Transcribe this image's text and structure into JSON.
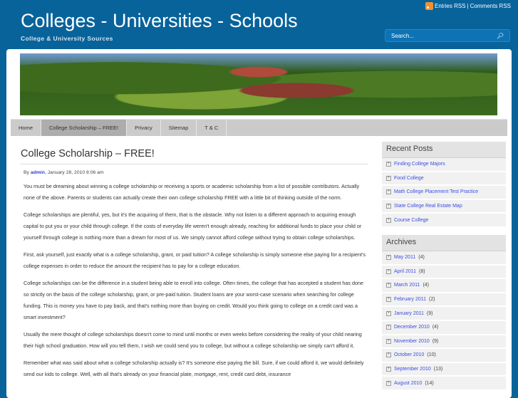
{
  "header": {
    "title": "Colleges - Universities - Schools",
    "tagline": "College & University Sources",
    "rss_entries": "Entries RSS",
    "rss_sep": "|",
    "rss_comments": "Comments RSS",
    "search_placeholder": "Search..."
  },
  "nav": [
    "Home",
    "College Scholarship – FREE!",
    "Privacy",
    "Sitemap",
    "T & C"
  ],
  "post": {
    "title": "College Scholarship – FREE!",
    "by": "By",
    "author": "admin",
    "date": ", January 28, 2010 8:06 am",
    "paragraphs": [
      "You must be dreaming about winning a college scholarship or receiving a sports or academic scholarship from a list of possible contributors. Actually none of the above. Parents or students can actually create their own college scholarship FREE with a little bit of thinking outside of the norm.",
      "College scholarships are plentiful, yes, but it's the acquiring of them, that is the obstacle. Why not listen to a different approach to acquiring enough capital to put you or your child through college. If the costs of everyday life weren't enough already, reaching for additional funds to place your child or yourself through college is nothing more than a dream for most of us. We simply cannot afford college without trying to obtain college scholarships.",
      "First, ask yourself, just exactly what is a college scholarship, grant, or paid tuition? A college scholarship is simply someone else paying for a recipient's college expenses in order to reduce the amount the recipient has to pay for a college education.",
      "College scholarships can be the difference in a student being able to enroll into college. Often times, the college that has accepted a student has done so strictly on the basis of the college scholarship, grant, or pre-paid tuition. Student loans are your worst-case scenario when searching for college funding. This is money you have to pay back, and that's nothing more than buying on credit. Would you think going to college on a credit card was a smart investment?",
      "Usually the mere thought of college scholarships doesn't come to mind until months or even weeks before considering the reality of your child nearing their high school graduation. How will you tell them, I wish we could send you to college, but without a college scholarship we simply can't afford it.",
      "Remember what was said about what a college scholarship actually is? It's someone else paying the bill. Sure, if we could afford it, we would definitely send our kids to college. Well, with all that's already on your financial plate, mortgage, rent, credit card debt, insurance"
    ]
  },
  "sidebar": {
    "recent_title": "Recent Posts",
    "recent": [
      "Finding College Majors",
      "Food College",
      "Math College Placement Test Practice",
      "State College Real Estate Map",
      "Course College"
    ],
    "archives_title": "Archives",
    "archives": [
      {
        "label": "May 2011",
        "count": "(4)"
      },
      {
        "label": "April 2011",
        "count": "(8)"
      },
      {
        "label": "March 2011",
        "count": "(4)"
      },
      {
        "label": "February 2011",
        "count": "(2)"
      },
      {
        "label": "January 2011",
        "count": "(9)"
      },
      {
        "label": "December 2010",
        "count": "(4)"
      },
      {
        "label": "November 2010",
        "count": "(9)"
      },
      {
        "label": "October 2010",
        "count": "(10)"
      },
      {
        "label": "September 2010",
        "count": "(13)"
      },
      {
        "label": "August 2010",
        "count": "(14)"
      }
    ]
  }
}
